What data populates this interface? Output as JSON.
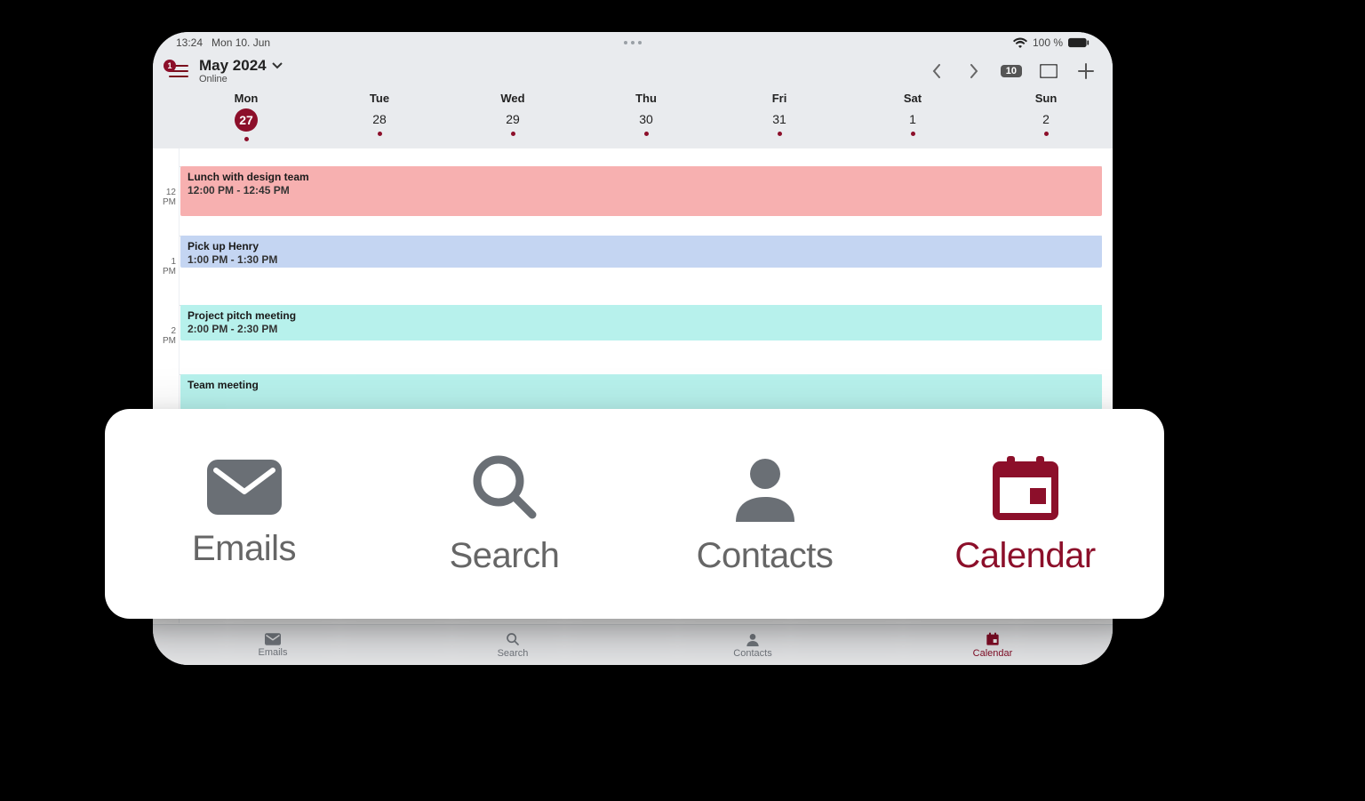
{
  "status": {
    "time": "13:24",
    "date": "Mon 10. Jun",
    "battery": "100 %"
  },
  "header": {
    "title": "May 2024",
    "subtitle": "Online",
    "badge": "1",
    "day_badge": "10"
  },
  "weekdays": [
    {
      "name": "Mon",
      "num": "27",
      "today": true
    },
    {
      "name": "Tue",
      "num": "28",
      "today": false
    },
    {
      "name": "Wed",
      "num": "29",
      "today": false
    },
    {
      "name": "Thu",
      "num": "30",
      "today": false
    },
    {
      "name": "Fri",
      "num": "31",
      "today": false
    },
    {
      "name": "Sat",
      "num": "1",
      "today": false
    },
    {
      "name": "Sun",
      "num": "2",
      "today": false
    }
  ],
  "hours": {
    "h12a": "12",
    "h12b": "PM",
    "h1a": "1",
    "h1b": "PM",
    "h2a": "2",
    "h2b": "PM"
  },
  "events": {
    "e0": {
      "title": "Lunch with design team",
      "time": "12:00 PM - 12:45 PM"
    },
    "e1": {
      "title": "Pick up Henry",
      "time": "1:00 PM - 1:30 PM"
    },
    "e2": {
      "title": "Project pitch meeting",
      "time": "2:00 PM - 2:30 PM"
    },
    "e3": {
      "title": "Team meeting",
      "time": ""
    }
  },
  "nav": {
    "emails": "Emails",
    "search": "Search",
    "contacts": "Contacts",
    "calendar": "Calendar"
  }
}
